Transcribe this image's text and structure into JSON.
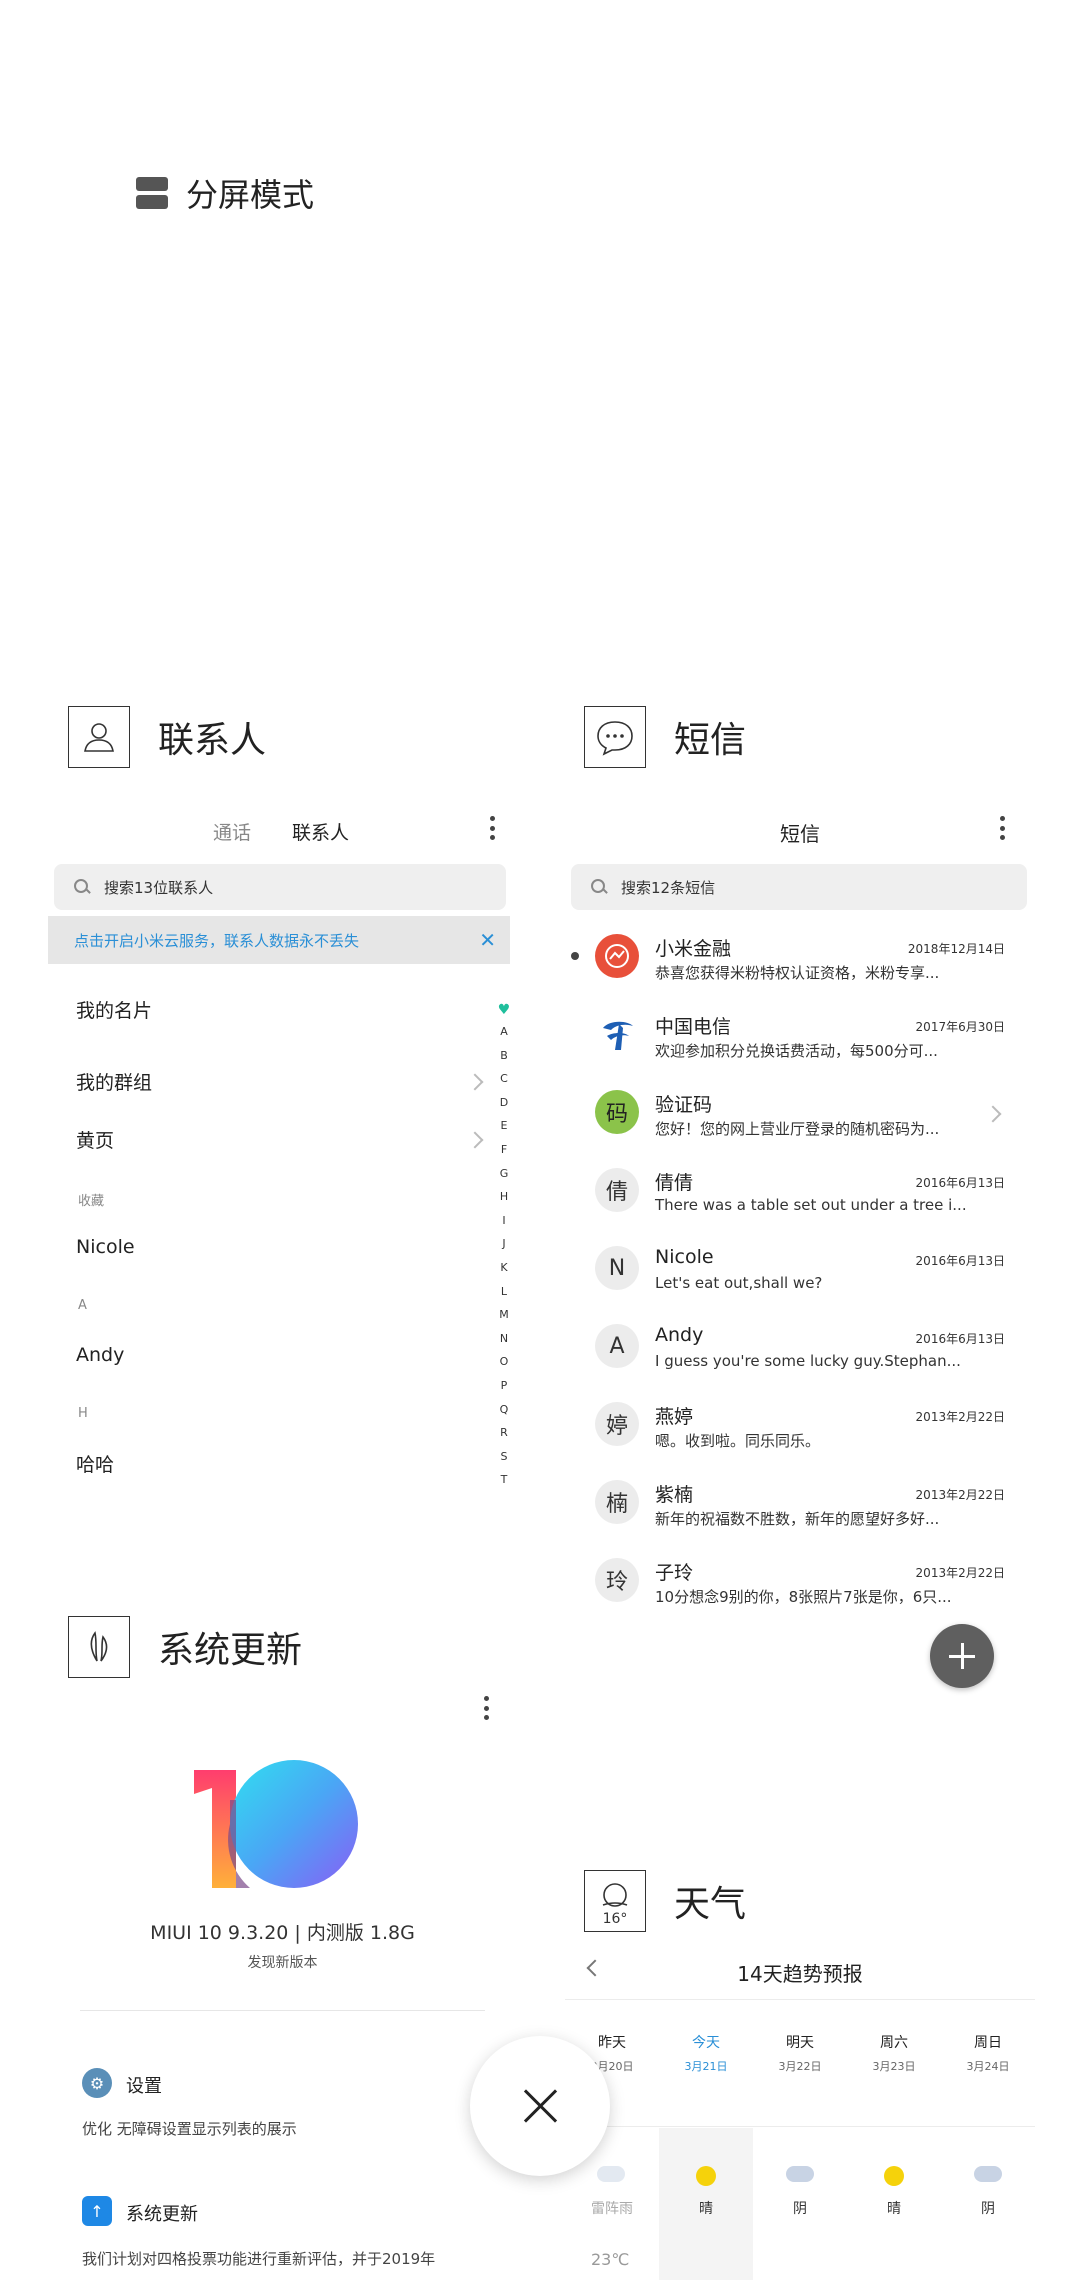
{
  "split_screen": {
    "label": "分屏模式"
  },
  "cards": {
    "contacts": {
      "app_title": "联系人",
      "tabs": [
        "通话",
        "联系人"
      ],
      "search_placeholder": "搜索13位联系人",
      "cloud_banner": "点击开启小米云服务，联系人数据永不丢失",
      "rows": {
        "my_card": "我的名片",
        "my_groups": "我的群组",
        "yellow_pages": "黄页"
      },
      "sections": {
        "favorites": "收藏",
        "a": "A",
        "h": "H"
      },
      "contacts": [
        "Nicole",
        "Andy",
        "哈哈"
      ],
      "alphabet": [
        "A",
        "B",
        "C",
        "D",
        "E",
        "F",
        "G",
        "H",
        "I",
        "J",
        "K",
        "L",
        "M",
        "N",
        "O",
        "P",
        "Q",
        "R",
        "S",
        "T"
      ]
    },
    "messages": {
      "app_title": "短信",
      "header_title": "短信",
      "search_placeholder": "搜索12条短信",
      "items": [
        {
          "avatar": "",
          "name": "小米金融",
          "date": "2018年12月14日",
          "snippet": "恭喜您获得米粉特权认证资格，米粉专享...",
          "unread": true
        },
        {
          "avatar": "",
          "name": "中国电信",
          "date": "2017年6月30日",
          "snippet": "欢迎参加积分兑换话费活动，每500分可..."
        },
        {
          "avatar": "码",
          "name": "验证码",
          "date": "",
          "snippet": "您好！您的网上营业厅登录的随机密码为..."
        },
        {
          "avatar": "倩",
          "name": "倩倩",
          "date": "2016年6月13日",
          "snippet": "There was a table set out under a tree i..."
        },
        {
          "avatar": "N",
          "name": "Nicole",
          "date": "2016年6月13日",
          "snippet": "Let's eat out,shall we?"
        },
        {
          "avatar": "A",
          "name": "Andy",
          "date": "2016年6月13日",
          "snippet": "I guess you're some lucky guy.Stephan..."
        },
        {
          "avatar": "婷",
          "name": "燕婷",
          "date": "2013年2月22日",
          "snippet": "嗯。收到啦。同乐同乐。"
        },
        {
          "avatar": "楠",
          "name": "紫楠",
          "date": "2013年2月22日",
          "snippet": "新年的祝福数不胜数，新年的愿望好多好..."
        },
        {
          "avatar": "玲",
          "name": "子玲",
          "date": "2013年2月22日",
          "snippet": "10分想念9别的你，8张照片7张是你，6只..."
        }
      ],
      "colors": {
        "xiaomi_finance": "#e8503a",
        "verification": "#8bc34a",
        "telecom": "#1e5fb4"
      }
    },
    "system_update": {
      "app_title": "系统更新",
      "version": "MIUI 10 9.3.20 | 内测版 1.8G",
      "new_version": "发现新版本",
      "items": [
        {
          "title": "设置",
          "desc": "优化 无障碍设置显示列表的展示"
        },
        {
          "title": "系统更新",
          "desc": "我们计划对四格投票功能进行重新评估，并于2019年"
        }
      ]
    },
    "weather": {
      "app_title": "天气",
      "icon_temp": "16°",
      "header_title": "14天趋势预报",
      "days": [
        {
          "day": "昨天",
          "date": "3月20日",
          "cond": "雷阵雨",
          "icon": "storm"
        },
        {
          "day": "今天",
          "date": "3月21日",
          "cond": "晴",
          "icon": "sun"
        },
        {
          "day": "明天",
          "date": "3月22日",
          "cond": "阴",
          "icon": "cloud"
        },
        {
          "day": "周六",
          "date": "3月23日",
          "cond": "晴",
          "icon": "sun"
        },
        {
          "day": "周日",
          "date": "3月24日",
          "cond": "阴",
          "icon": "cloud"
        }
      ],
      "temp": "23℃"
    }
  }
}
